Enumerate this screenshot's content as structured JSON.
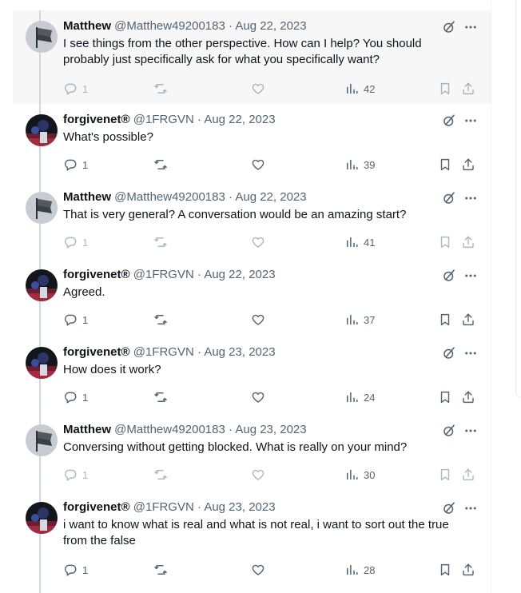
{
  "tweets": [
    {
      "name": "Matthew",
      "handle": "@Matthew49200183",
      "dot": "·",
      "date": "Aug 22, 2023",
      "text": "I see things from the other perspective.  How can I help?  You should probably just specifically ask for what you specifically want?",
      "replies": "1",
      "views": "42",
      "avatar": "flag",
      "faded": true,
      "highlight": true
    },
    {
      "name": "forgivenet®",
      "handle": "@1FRGVN",
      "dot": "·",
      "date": "Aug 22, 2023",
      "text": "What's possible?",
      "replies": "1",
      "views": "39",
      "avatar": "photo",
      "faded": false,
      "highlight": false
    },
    {
      "name": "Matthew",
      "handle": "@Matthew49200183",
      "dot": "·",
      "date": "Aug 22, 2023",
      "text": "That is very general?  A conversation would be an amazing start?",
      "replies": "1",
      "views": "41",
      "avatar": "flag",
      "faded": true,
      "highlight": false
    },
    {
      "name": "forgivenet®",
      "handle": "@1FRGVN",
      "dot": "·",
      "date": "Aug 22, 2023",
      "text": "Agreed.",
      "replies": "1",
      "views": "37",
      "avatar": "photo",
      "faded": false,
      "highlight": false
    },
    {
      "name": "forgivenet®",
      "handle": "@1FRGVN",
      "dot": "·",
      "date": "Aug 23, 2023",
      "text": "How does it work?",
      "replies": "1",
      "views": "24",
      "avatar": "photo",
      "faded": false,
      "highlight": false
    },
    {
      "name": "Matthew",
      "handle": "@Matthew49200183",
      "dot": "·",
      "date": "Aug 23, 2023",
      "text": "Conversing without getting blocked.  What is really on your mind?",
      "replies": "1",
      "views": "30",
      "avatar": "flag",
      "faded": true,
      "highlight": false
    },
    {
      "name": "forgivenet®",
      "handle": "@1FRGVN",
      "dot": "·",
      "date": "Aug 23, 2023",
      "text": "i want to know what is real and what is not real, i want to sort out the true from the false",
      "replies": "1",
      "views": "28",
      "avatar": "photo",
      "faded": false,
      "highlight": false
    }
  ],
  "icons": {
    "reply": "reply-icon",
    "retweet": "retweet-icon",
    "like": "like-icon",
    "views": "views-icon",
    "bookmark": "bookmark-icon",
    "share": "share-icon",
    "grok": "grok-icon",
    "more": "more-icon"
  },
  "colors": {
    "text": "#0f1419",
    "secondary": "#536471",
    "thread_line": "#cfd9de",
    "highlight_bg": "#f7f7f7"
  }
}
